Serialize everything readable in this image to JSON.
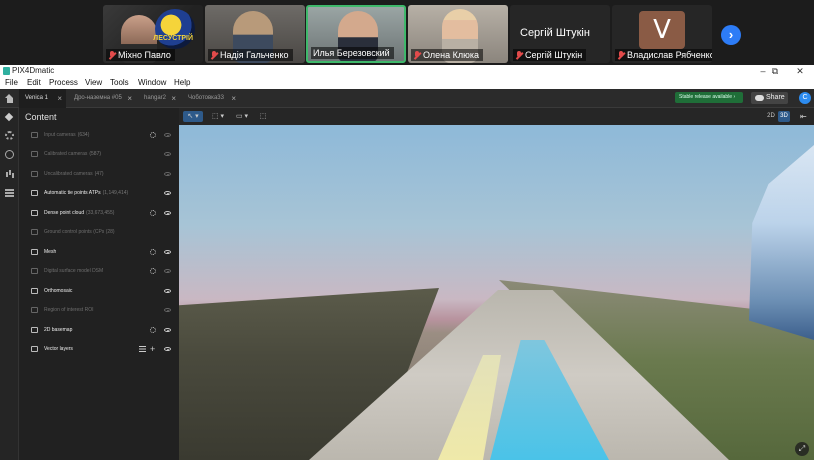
{
  "call": {
    "participants": [
      {
        "name": "Міхно Павло",
        "muted": true
      },
      {
        "name": "Надія Гальченко",
        "muted": true
      },
      {
        "name": "Илья Березовский",
        "muted": false,
        "speaking": true
      },
      {
        "name": "Олена Клюка",
        "muted": true
      },
      {
        "name": "Сергій Штукін",
        "muted": true,
        "display_name": "Сергій Штукін"
      },
      {
        "name": "Владислав Рябченко",
        "muted": true,
        "avatar_letter": "V"
      }
    ],
    "logo_text": "ЛЕСУСТРІЙ",
    "next_icon": "chevron-right-icon",
    "next_glyph": "›"
  },
  "window": {
    "title": "PIX4Dmatic",
    "controls": {
      "minimize": "–",
      "maximize": "⧉",
      "close": "✕"
    }
  },
  "menu": [
    "File",
    "Edit",
    "Process",
    "View",
    "Tools",
    "Window",
    "Help"
  ],
  "tabs": [
    {
      "label": "Venica 1",
      "active": true
    },
    {
      "label": "Дро-наземна #05",
      "active": false
    },
    {
      "label": "hangar2",
      "active": false
    },
    {
      "label": "Чоботовка33",
      "active": false
    }
  ],
  "header": {
    "release_badge": "Stable release available  ›",
    "share_label": "Share",
    "user_initial": "C"
  },
  "panel": {
    "title": "Content",
    "layers": [
      {
        "name": "Input cameras",
        "count": "(634)",
        "dim": true,
        "settings": true,
        "eye": true
      },
      {
        "name": "Calibrated cameras",
        "count": "(587)",
        "dim": true,
        "settings": false,
        "eye": true
      },
      {
        "name": "Uncalibrated cameras",
        "count": "(47)",
        "dim": true,
        "settings": false,
        "eye": true
      },
      {
        "name": "Automatic tie points ATPs",
        "count": "(1,149,414)",
        "dim": false,
        "settings": false,
        "eye": true
      },
      {
        "name": "Dense point cloud",
        "count": "(33,673,455)",
        "dim": false,
        "settings": true,
        "eye": true
      },
      {
        "name": "Ground control points (CPs (28)",
        "count": "",
        "dim": true,
        "settings": false,
        "eye": false
      },
      {
        "name": "Mesh",
        "count": "",
        "dim": false,
        "settings": true,
        "eye": true
      },
      {
        "name": "Digital surface model DSM",
        "count": "",
        "dim": true,
        "settings": true,
        "eye": true
      },
      {
        "name": "Orthomosaic",
        "count": "",
        "dim": false,
        "settings": false,
        "eye": true
      },
      {
        "name": "Region of interest ROI",
        "count": "",
        "dim": true,
        "settings": false,
        "eye": true
      },
      {
        "name": "2D basemap",
        "count": "",
        "dim": false,
        "settings": true,
        "eye": true
      },
      {
        "name": "Vector layers",
        "count": "",
        "dim": false,
        "settings": false,
        "eye": true,
        "vector": true
      }
    ]
  },
  "viewport": {
    "tools": {
      "select": "↖ ▾",
      "box": "⬚ ▾",
      "measure": "▭ ▾",
      "frame": "⬚"
    },
    "view_2d": "2D",
    "view_3d": "3D",
    "active_view": "3D",
    "collapse_glyph": "⇤",
    "fullscreen_glyph": "⤢"
  }
}
